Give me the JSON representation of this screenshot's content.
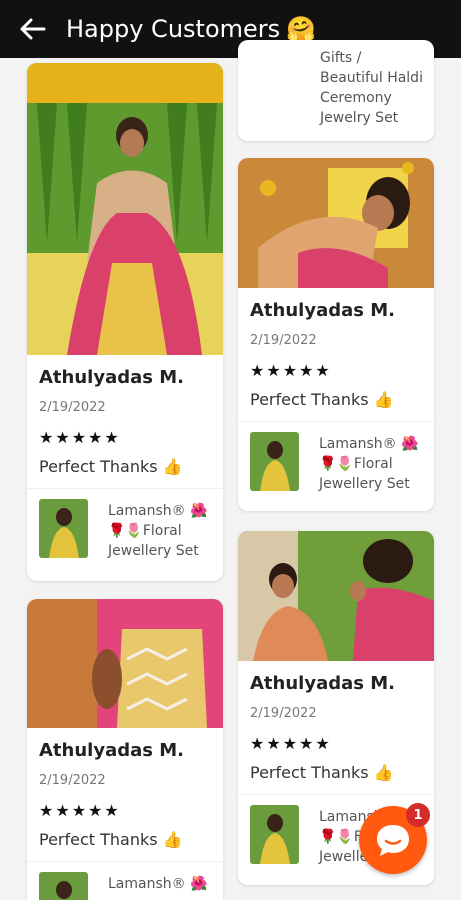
{
  "header": {
    "title": "Happy Customers",
    "emoji": "🤗"
  },
  "left": {
    "card1": {
      "name": "Athulyadas M.",
      "date": "2/19/2022",
      "rating": 5,
      "review": "Perfect Thanks",
      "review_emoji": "👍",
      "product": [
        "Lamansh® 🌺",
        "🌹🌷Floral",
        "Jewellery Set"
      ]
    },
    "card2": {
      "name": "Athulyadas M.",
      "date": "2/19/2022",
      "rating": 5,
      "review": "Perfect Thanks",
      "review_emoji": "👍",
      "product": [
        "Lamansh® 🌺"
      ]
    }
  },
  "right": {
    "card0": {
      "product": [
        "Gifts /",
        "Beautiful Haldi",
        "Ceremony",
        "Jewelry Set"
      ]
    },
    "card1": {
      "name": "Athulyadas M.",
      "date": "2/19/2022",
      "rating": 5,
      "review": "Perfect Thanks",
      "review_emoji": "👍",
      "product": [
        "Lamansh® 🌺",
        "🌹🌷Floral",
        "Jewellery Set"
      ]
    },
    "card2": {
      "name": "Athulyadas M.",
      "date": "2/19/2022",
      "rating": 5,
      "review": "Perfect Thanks",
      "review_emoji": "👍",
      "product": [
        "Lamansh®",
        "🌹🌷Floral",
        "Jewellery"
      ]
    }
  },
  "chat": {
    "badge_count": "1"
  },
  "colors": {
    "topbar": "#111111",
    "chat_button": "#ff5a10",
    "badge": "#d62b2b"
  },
  "icons": {
    "back": "arrow-left-icon",
    "chat": "chat-bubble-icon",
    "star": "star-icon"
  }
}
